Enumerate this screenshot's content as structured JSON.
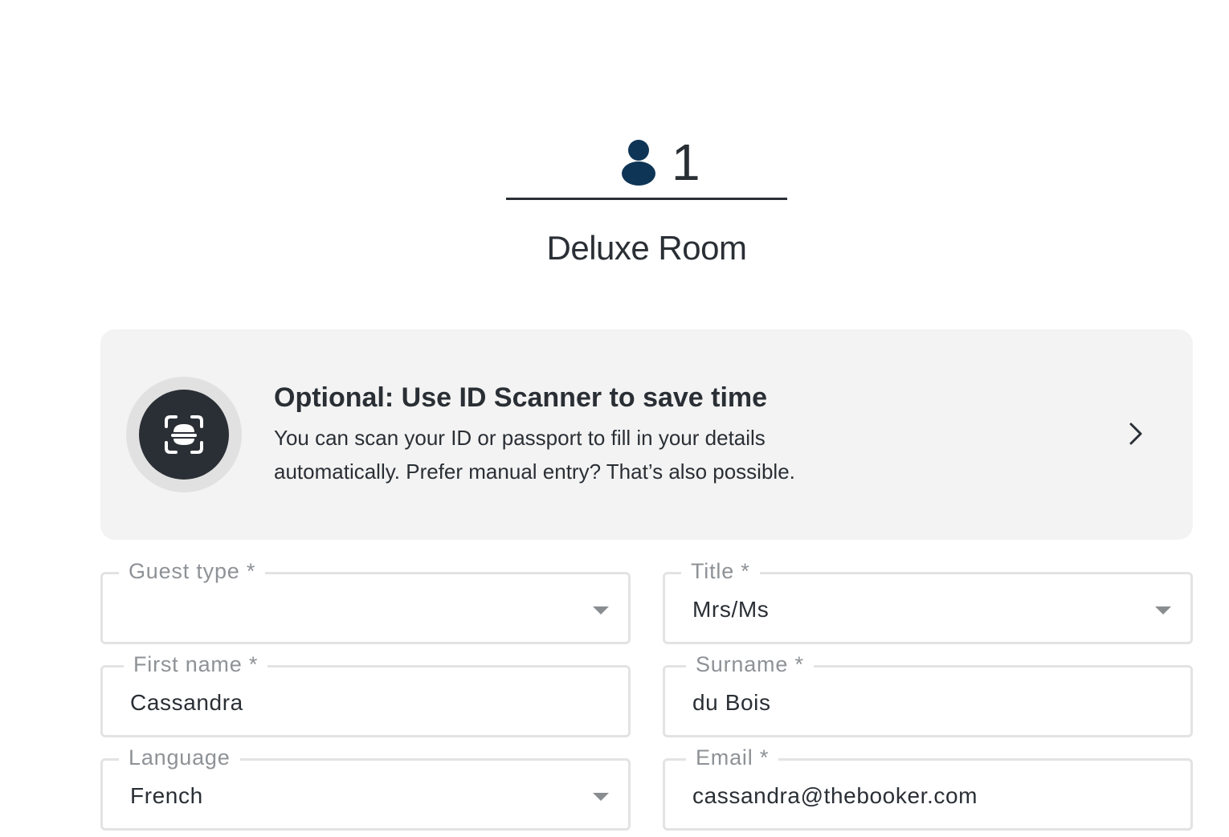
{
  "guest": {
    "number": "1",
    "icon": "person-icon",
    "icon_color": "#0f3556"
  },
  "room": {
    "name": "Deluxe Room"
  },
  "scanner": {
    "icon": "id-scan-icon",
    "title": "Optional: Use ID Scanner to save time",
    "description": "You can scan your ID or passport to fill in your details automatically. Prefer manual entry? That’s also possible.",
    "chevron_icon": "chevron-right-icon"
  },
  "form": {
    "guest_type": {
      "label": "Guest type *",
      "value": ""
    },
    "title": {
      "label": "Title *",
      "value": "Mrs/Ms"
    },
    "first_name": {
      "label": "First name *",
      "value": "Cassandra"
    },
    "surname": {
      "label": "Surname *",
      "value": "du Bois"
    },
    "language": {
      "label": "Language",
      "value": "French"
    },
    "email": {
      "label": "Email *",
      "value": "cassandra@thebooker.com"
    }
  },
  "colors": {
    "text": "#2a2f35",
    "label": "#8e9296",
    "border": "#e3e3e3",
    "card_bg": "#f3f3f3"
  }
}
